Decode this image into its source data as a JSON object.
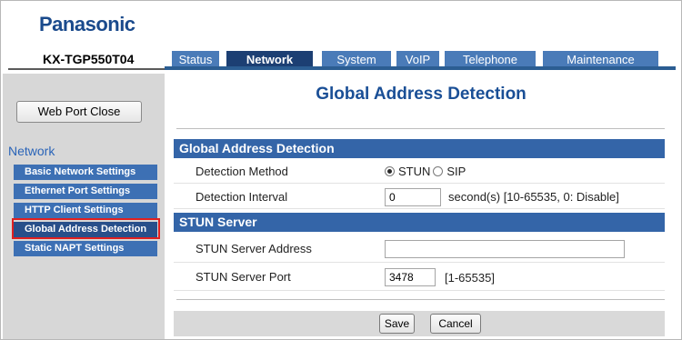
{
  "brand": "Panasonic",
  "model": "KX-TGP550T04",
  "tabs": [
    {
      "label": "Status",
      "active": false
    },
    {
      "label": "Network",
      "active": true
    },
    {
      "label": "System",
      "active": false
    },
    {
      "label": "VoIP",
      "active": false
    },
    {
      "label": "Telephone",
      "active": false
    },
    {
      "label": "Maintenance",
      "active": false
    }
  ],
  "sidebar": {
    "web_port_close_label": "Web Port Close",
    "section_title": "Network",
    "items": [
      {
        "label": "Basic Network Settings"
      },
      {
        "label": "Ethernet Port Settings"
      },
      {
        "label": "HTTP Client Settings"
      },
      {
        "label": "Global Address Detection",
        "selected": true
      },
      {
        "label": "Static NAPT Settings"
      }
    ]
  },
  "page": {
    "title": "Global Address Detection",
    "sections": {
      "gad": {
        "heading": "Global Address Detection",
        "detection_method": {
          "label": "Detection Method",
          "options": [
            "STUN",
            "SIP"
          ],
          "selected": "STUN"
        },
        "detection_interval": {
          "label": "Detection Interval",
          "value": "0",
          "hint": "second(s) [10-65535, 0: Disable]"
        }
      },
      "stun": {
        "heading": "STUN Server",
        "server_address": {
          "label": "STUN Server Address",
          "value": ""
        },
        "server_port": {
          "label": "STUN Server Port",
          "value": "3478",
          "hint": "[1-65535]"
        }
      }
    },
    "buttons": {
      "save": "Save",
      "cancel": "Cancel"
    }
  }
}
